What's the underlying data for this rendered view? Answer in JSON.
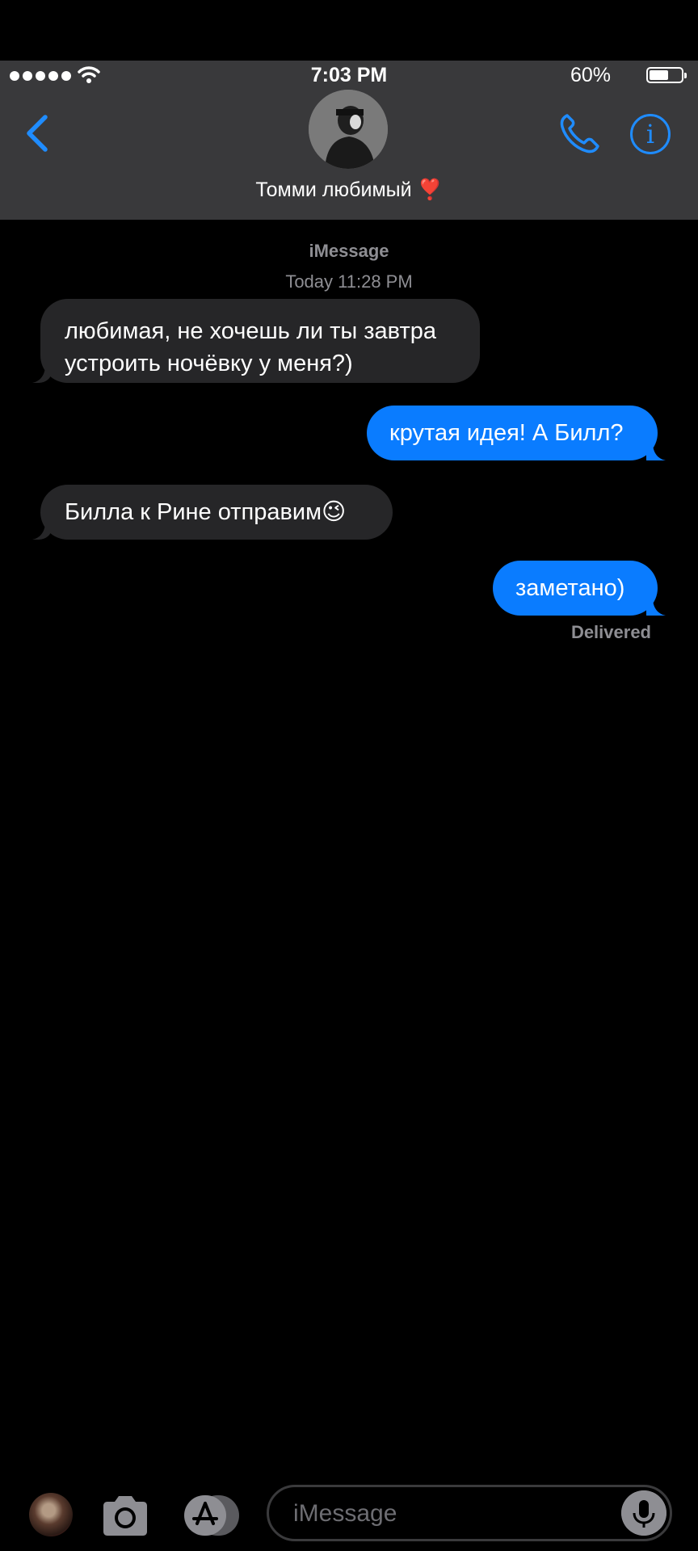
{
  "status_bar": {
    "time": "7:03 PM",
    "battery": "60%",
    "battery_level": 0.6,
    "signal_icon": "signal-dots-icon",
    "wifi_icon": "wifi-icon"
  },
  "header": {
    "contact_name": "Томми любимый ❣️",
    "back_icon": "chevron-left-icon",
    "call_icon": "phone-icon",
    "info_icon": "info-icon",
    "info_glyph": "i",
    "accent_color": "#1f8cff"
  },
  "thread": {
    "service": "iMessage",
    "timestamp": "Today 11:28 PM",
    "messages": [
      {
        "direction": "incoming",
        "text": "любимая, не хочешь ли ты завтра устроить ночёвку у меня?)"
      },
      {
        "direction": "outgoing",
        "text": "крутая идея! А Билл?"
      },
      {
        "direction": "incoming",
        "text": "Билла к Рине отправим😉"
      },
      {
        "direction": "outgoing",
        "text": "заметано)"
      }
    ],
    "delivery_status": "Delivered",
    "incoming_color": "#262628",
    "outgoing_color": "#0a7cff"
  },
  "input_bar": {
    "placeholder": "iMessage",
    "photos_icon": "photos-app-icon",
    "camera_icon": "camera-icon",
    "appstore_icon": "app-store-icon",
    "mic_icon": "microphone-icon"
  }
}
